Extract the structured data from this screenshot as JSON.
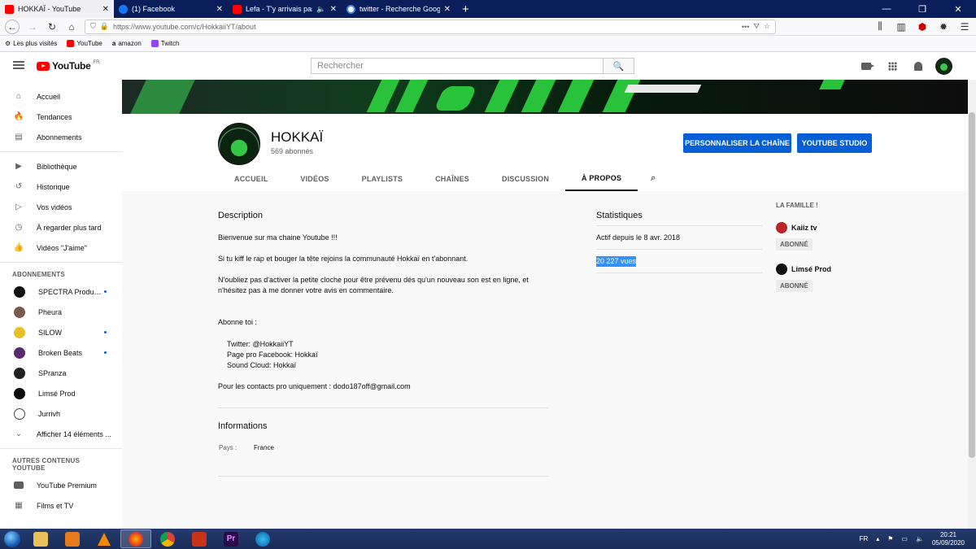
{
  "browser": {
    "tabs": [
      {
        "title": "HOKKAÏ - YouTube",
        "favicon": "youtube-icon",
        "active": true
      },
      {
        "title": "(1) Facebook",
        "favicon": "facebook-icon",
        "active": false
      },
      {
        "title": "Lefa - T'y arrivais pas (Clip",
        "favicon": "youtube-icon",
        "active": false
      },
      {
        "title": "twitter - Recherche Google",
        "favicon": "google-icon",
        "active": false
      }
    ],
    "url": "https://www.youtube.com/c/HokkaiiYT/about",
    "bookmarks": [
      {
        "label": "Les plus visités"
      },
      {
        "label": "YouTube"
      },
      {
        "label": "amazon"
      },
      {
        "label": "Twitch"
      }
    ]
  },
  "masthead": {
    "logo_text": "YouTube",
    "country": "FR",
    "search_placeholder": "Rechercher"
  },
  "sidebar": {
    "main": [
      {
        "label": "Accueil",
        "icon": "home-icon"
      },
      {
        "label": "Tendances",
        "icon": "flame-icon"
      },
      {
        "label": "Abonnements",
        "icon": "subscriptions-icon"
      }
    ],
    "library": [
      {
        "label": "Bibliothèque",
        "icon": "library-icon"
      },
      {
        "label": "Historique",
        "icon": "history-icon"
      },
      {
        "label": "Vos vidéos",
        "icon": "play-icon"
      },
      {
        "label": "À regarder plus tard",
        "icon": "clock-icon"
      },
      {
        "label": "Vidéos \"J'aime\"",
        "icon": "thumb-up-icon"
      }
    ],
    "subscriptions_heading": "ABONNEMENTS",
    "subscriptions": [
      {
        "label": "SPECTRA Producti...",
        "new": true
      },
      {
        "label": "Pheura",
        "new": false
      },
      {
        "label": "SILOW",
        "new": true
      },
      {
        "label": "Broken Beats",
        "new": true
      },
      {
        "label": "SPranza",
        "new": false
      },
      {
        "label": "Limsé Prod",
        "new": false
      },
      {
        "label": "Jurrivh",
        "new": false
      }
    ],
    "show_more": "Afficher 14 éléments ...",
    "more_heading": "AUTRES CONTENUS YOUTUBE",
    "more": [
      {
        "label": "YouTube Premium",
        "icon": "youtube-icon"
      },
      {
        "label": "Films et TV",
        "icon": "film-icon"
      }
    ]
  },
  "channel": {
    "name": "HOKKAÏ",
    "subscribers": "569 abonnés",
    "customize_button": "PERSONNALISER LA CHAÎNE",
    "studio_button": "YOUTUBE STUDIO",
    "tabs": [
      "ACCUEIL",
      "VIDÉOS",
      "PLAYLISTS",
      "CHAÎNES",
      "DISCUSSION",
      "À PROPOS"
    ],
    "active_tab": "À PROPOS"
  },
  "about": {
    "description_title": "Description",
    "description": [
      "Bienvenue sur ma chaine Youtube !!!",
      "Si tu kiff le rap et bouger la tête rejoins la communauté Hokkaï en t'abonnant.",
      "N'oubliez pas d'activer la petite cloche pour être prévenu dés qu'un nouveau son est en ligne, et n'hésitez pas à me donner votre avis en commentaire.",
      "Abonne toi :",
      "Twitter: @HokkaiiYT",
      "Page pro Facebook: Hokkaï",
      "Sound Cloud: Hokkaï",
      "Pour les contacts pro uniquement : dodo187off@gmail.com"
    ],
    "info_title": "Informations",
    "country_label": "Pays :",
    "country_value": "France",
    "stats_title": "Statistiques",
    "joined": "Actif depuis le 8 avr. 2018",
    "views": "20 227 vues",
    "family_title": "LA FAMILLE !",
    "family": [
      {
        "name": "Kaiiz tv",
        "button": "ABONNÉ"
      },
      {
        "name": "Limsé Prod",
        "button": "ABONNÉ"
      }
    ]
  },
  "taskbar": {
    "lang": "FR",
    "time": "20:21",
    "date": "05/09/2020"
  }
}
